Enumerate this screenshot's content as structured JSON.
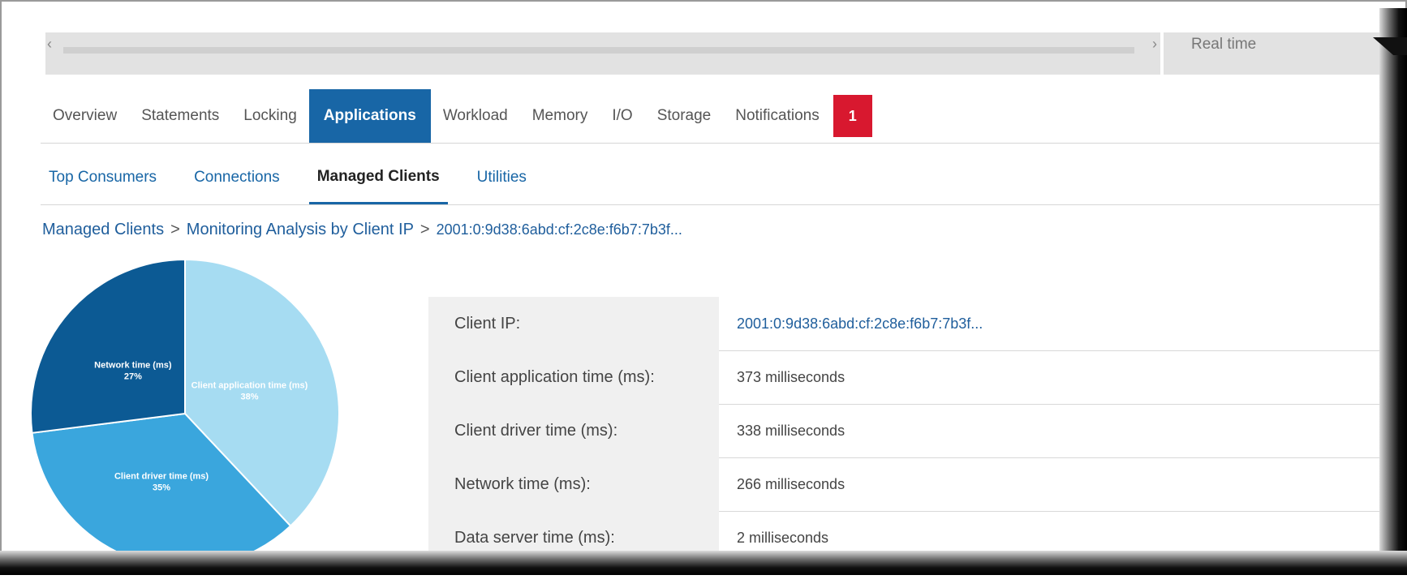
{
  "toolbar": {
    "time_mode": "Real time",
    "scroll_left_icon": "chevron-left-icon",
    "scroll_right_icon": "chevron-right-icon"
  },
  "main_tabs": [
    {
      "label": "Overview",
      "active": false
    },
    {
      "label": "Statements",
      "active": false
    },
    {
      "label": "Locking",
      "active": false
    },
    {
      "label": "Applications",
      "active": true
    },
    {
      "label": "Workload",
      "active": false
    },
    {
      "label": "Memory",
      "active": false
    },
    {
      "label": "I/O",
      "active": false
    },
    {
      "label": "Storage",
      "active": false
    },
    {
      "label": "Notifications",
      "active": false
    }
  ],
  "notifications_count": "1",
  "sub_tabs": [
    {
      "label": "Top Consumers",
      "active": false
    },
    {
      "label": "Connections",
      "active": false
    },
    {
      "label": "Managed Clients",
      "active": true
    },
    {
      "label": "Utilities",
      "active": false
    }
  ],
  "breadcrumb": {
    "level1": "Managed Clients",
    "level2": "Monitoring Analysis by Client IP",
    "current": "2001:0:9d38:6abd:cf:2c8e:f6b7:7b3f..."
  },
  "chart_data": {
    "type": "pie",
    "slices": [
      {
        "label": "Client application time (ms)",
        "percent": 38,
        "display": "38%",
        "color": "#a6dcf2"
      },
      {
        "label": "Client driver time (ms)",
        "percent": 35,
        "display": "35%",
        "color": "#3aa6dd"
      },
      {
        "label": "Network time (ms)",
        "percent": 27,
        "display": "27%",
        "color": "#0c5a94"
      }
    ],
    "start_angle_deg": 0
  },
  "details": [
    {
      "label": "Client IP:",
      "value": "2001:0:9d38:6abd:cf:2c8e:f6b7:7b3f..."
    },
    {
      "label": "Client application time (ms):",
      "value": "373 milliseconds"
    },
    {
      "label": "Client driver time (ms):",
      "value": "338 milliseconds"
    },
    {
      "label": "Network time (ms):",
      "value": "266 milliseconds"
    },
    {
      "label": "Data server time (ms):",
      "value": "2 milliseconds"
    }
  ],
  "colors": {
    "accent": "#1866a6",
    "badge": "#d8182f",
    "link": "#1f5e9c"
  }
}
